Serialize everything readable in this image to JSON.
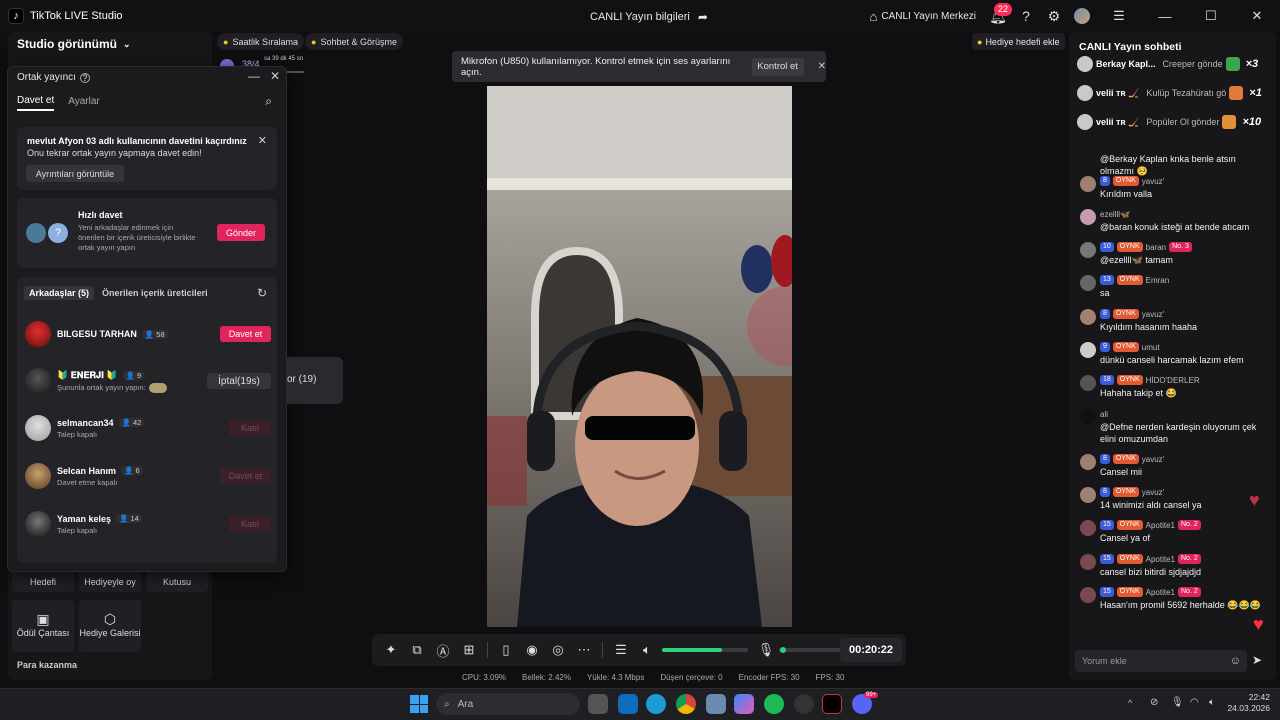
{
  "app": {
    "title": "TikTok LIVE Studio"
  },
  "titlebar": {
    "center_title": "CANLI Yayın bilgileri",
    "live_center": "CANLI Yayın Merkezi",
    "notif_count": "22"
  },
  "studio": {
    "header": "Studio görünümü",
    "buttons": [
      {
        "label": "Hediyeyle oy"
      },
      {
        "label": "Kutusu"
      },
      {
        "label": "Hedefi"
      },
      {
        "label": "Ödül Çantası"
      },
      {
        "label": "Hediye Galerisi"
      }
    ],
    "para_kazanma": "Para kazanma"
  },
  "pills": {
    "saatlik": "Saatlik Sıralama",
    "sohbet": "Sohbet & Görüşme",
    "countdown": "38/4",
    "timer_small": "sa 39 dk 45 sn"
  },
  "cohost": {
    "title": "Ortak yayıncı",
    "tab_invite": "Davet et",
    "tab_settings": "Ayarlar",
    "missed_title": "mevlut Afyon 03 adlı kullanıcının davetini kaçırdınız",
    "missed_sub": "Onu tekrar ortak yayın yapmaya davet edin!",
    "details_btn": "Ayrıntıları görüntüle",
    "quick_title": "Hızlı davet",
    "quick_desc": "Yeni arkadaşlar edinmek için önerilen bir içerik üreticisiyle birlikte ortak yayın yapın",
    "send_btn": "Gönder",
    "friends_tab": "Arkadaşlar (5)",
    "suggested_tab": "Önerilen içerik üreticileri",
    "friends": [
      {
        "name": "BILGESU TARHAN",
        "count": "58",
        "sub": "",
        "action": "Davet et"
      },
      {
        "name": "🔰 𝐄𝐍𝐄𝐑𝐉𝐈 🔰",
        "count": "9",
        "sub": "Şununla ortak yayın yapın:",
        "action": "İptal(19s)"
      },
      {
        "name": "selmancan34",
        "count": "42",
        "sub": "Talep kapalı",
        "action": "Katıl"
      },
      {
        "name": "Selcan Hanım",
        "count": "6",
        "sub": "Davet etme kapalı",
        "action": "Davet et"
      },
      {
        "name": "Yaman keleş",
        "count": "14",
        "sub": "Talep kapalı",
        "action": "Katıl"
      }
    ]
  },
  "tile": {
    "text": "or (19)"
  },
  "notice": {
    "text": "Mikrofon (U850) kullanılamıyor. Kontrol etmek için ses ayarlarını açın.",
    "button": "Kontrol et"
  },
  "controls": {
    "timer": "00:20:22",
    "volume": 0.7,
    "mic_level": 0.02
  },
  "status": {
    "cpu": "CPU: 3.09%",
    "mem": "Bellek: 2.42%",
    "upload": "Yükle: 4.3 Mbps",
    "dropped": "Düşen çerçeve: 0",
    "encfps": "Encoder FPS: 30",
    "fps": "FPS: 30"
  },
  "gift_goal": "Hediye hedefi ekle",
  "chat": {
    "title": "CANLI Yayın sohbeti",
    "gifts": [
      {
        "user": "Berkay Kapl...",
        "msg": "Creeper gönde",
        "mult": "×3",
        "color": "#3aa84a"
      },
      {
        "user": "velii ᴛʀ 🏒",
        "msg": "Kulüp Tezahüratı gö",
        "mult": "×1",
        "color": "#e07a3a"
      },
      {
        "user": "velii ᴛʀ 🏒",
        "msg": "Popüler Ol gönder",
        "mult": "×10",
        "color": "#e0903a"
      }
    ],
    "messages": [
      {
        "lvl": "",
        "user": "",
        "rank": "",
        "text": "@Berkay Kaplan knka benle atsın olmazmı 🥺"
      },
      {
        "lvl": "8",
        "user": "yavuz'",
        "rank": "",
        "text": "Kırıldım valla"
      },
      {
        "lvl": "",
        "user": "ezellll🦋",
        "rank": "",
        "text": "@baran konuk isteği at bende atıcam"
      },
      {
        "lvl": "10",
        "user": "baran",
        "rank": "No. 3",
        "text": "@ezellll🦋 tamam"
      },
      {
        "lvl": "13",
        "user": "Emran",
        "rank": "",
        "text": "sa"
      },
      {
        "lvl": "8",
        "user": "yavuz'",
        "rank": "",
        "text": "Kıyıldım hasanım haaha"
      },
      {
        "lvl": "9",
        "user": "umut",
        "rank": "",
        "text": "dünkü canseli harcamak lazım efem"
      },
      {
        "lvl": "18",
        "user": "HİDO'DERLER",
        "rank": "",
        "text": "Hahaha takip et 😂"
      },
      {
        "lvl": "",
        "user": "ali",
        "rank": "",
        "text": "@Defne nerden kardeşin oluyorum çek elini omuzumdan"
      },
      {
        "lvl": "8",
        "user": "yavuz'",
        "rank": "",
        "text": "Cansel mii"
      },
      {
        "lvl": "8",
        "user": "yavuz'",
        "rank": "",
        "text": "14 winimizi aldı cansel ya"
      },
      {
        "lvl": "15",
        "user": "Apotite1",
        "rank": "No. 2",
        "text": "Cansel ya of"
      },
      {
        "lvl": "15",
        "user": "Apotite1",
        "rank": "No. 2",
        "text": "cansel bizi bitirdi sjdjajdjd"
      },
      {
        "lvl": "15",
        "user": "Apotite1",
        "rank": "No. 2",
        "text": "Hasan'ım promil 5692 herhalde 😂😂😂"
      }
    ],
    "oynk": "OYNK",
    "comment_placeholder": "Yorum ekle"
  },
  "taskbar": {
    "search": "Ara",
    "time": "22:42",
    "date": "24.03.2026",
    "badge": "99+"
  }
}
